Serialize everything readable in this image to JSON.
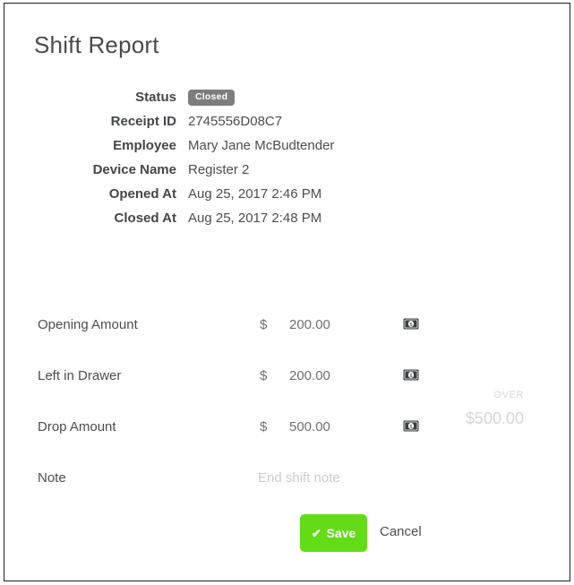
{
  "page": {
    "title": "Shift Report"
  },
  "details": {
    "rows": [
      {
        "label": "Status",
        "value": "Closed",
        "type": "badge"
      },
      {
        "label": "Receipt ID",
        "value": "2745556D08C7",
        "type": "text"
      },
      {
        "label": "Employee",
        "value": "Mary Jane McBudtender",
        "type": "text"
      },
      {
        "label": "Device Name",
        "value": "Register 2",
        "type": "text"
      },
      {
        "label": "Opened At",
        "value": "Aug 25, 2017 2:46 PM",
        "type": "text"
      },
      {
        "label": "Closed At",
        "value": "Aug 25, 2017 2:48 PM",
        "type": "text"
      }
    ]
  },
  "amounts": {
    "currency_symbol": "$",
    "rows": [
      {
        "label": "Opening Amount",
        "value": "200.00",
        "icon": "money-bill-icon"
      },
      {
        "label": "Left in Drawer",
        "value": "200.00",
        "icon": "money-bill-icon"
      },
      {
        "label": "Drop Amount",
        "value": "500.00",
        "icon": "money-bill-icon"
      }
    ]
  },
  "note": {
    "label": "Note",
    "value": "",
    "placeholder": "End shift note"
  },
  "variance": {
    "label": "OVER",
    "amount": "$500.00"
  },
  "actions": {
    "save_label": "Save",
    "save_icon": "check-icon",
    "cancel_label": "Cancel"
  },
  "colors": {
    "save_green": "#63dc17",
    "badge_gray": "#7d7d7d",
    "text_dark": "#4b4e52",
    "text_muted": "#6d7074",
    "text_faint": "#d3d6d9",
    "frame_border": "#1d1d1d"
  }
}
